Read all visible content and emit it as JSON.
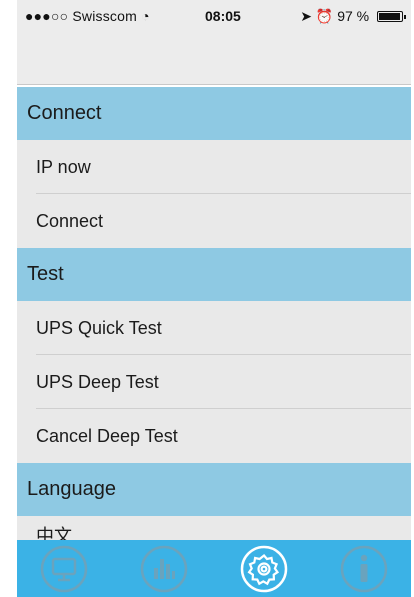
{
  "status_bar": {
    "carrier": "●●●○○ Swisscom",
    "time": "08:05",
    "battery": "97 %",
    "battery_level": 0.97,
    "icons": [
      "signal-dots-icon",
      "wifi-icon",
      "location-arrow-icon",
      "alarm-icon",
      "battery-icon"
    ]
  },
  "sections": {
    "connect": {
      "title": "Connect",
      "items": [
        "IP now",
        "Connect"
      ]
    },
    "test": {
      "title": "Test",
      "items": [
        "UPS Quick Test",
        "UPS Deep Test",
        "Cancel Deep Test"
      ]
    },
    "language": {
      "title": "Language",
      "items": [
        "中文"
      ]
    }
  },
  "tab_bar": {
    "tabs": [
      {
        "icon": "monitor-icon",
        "selected": false
      },
      {
        "icon": "bar-chart-icon",
        "selected": false
      },
      {
        "icon": "gear-icon",
        "selected": true
      },
      {
        "icon": "info-icon",
        "selected": false
      }
    ]
  },
  "colors": {
    "section_header": "#8ec9e3",
    "row_background": "#e9e9e9",
    "tab_bar": "#3bb2e6",
    "tab_icon_inactive": "#6aa3bd",
    "tab_icon_active": "#ffffff"
  }
}
